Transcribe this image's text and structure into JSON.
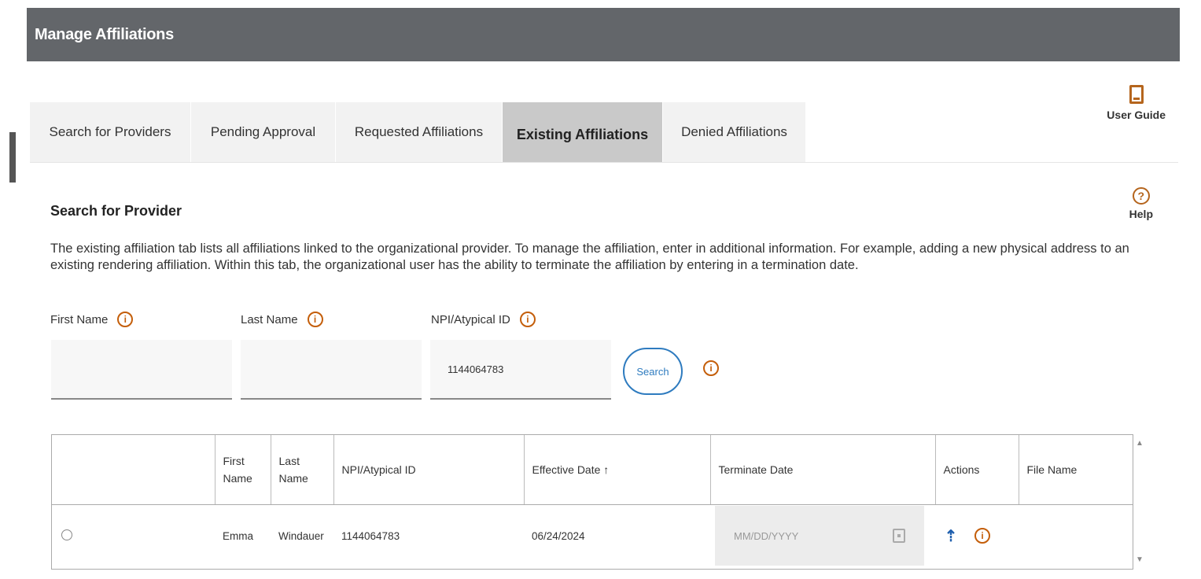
{
  "header": {
    "title": "Manage Affiliations"
  },
  "tabs": [
    {
      "label": "Search for Providers",
      "active": false
    },
    {
      "label": "Pending Approval",
      "active": false
    },
    {
      "label": "Requested Affiliations",
      "active": false
    },
    {
      "label": "Existing Affiliations",
      "active": true
    },
    {
      "label": "Denied Affiliations",
      "active": false
    }
  ],
  "user_guide": {
    "label": "User Guide",
    "icon": "book-icon"
  },
  "help": {
    "label": "Help",
    "icon": "question-circle-icon"
  },
  "section": {
    "title": "Search for Provider",
    "description": "The existing affiliation tab lists all affiliations linked to the organizational provider. To manage the affiliation, enter in additional information. For example, adding a new physical address to an existing rendering affiliation. Within this tab, the organizational user has the ability to terminate the affiliation by entering in a termination date."
  },
  "search_form": {
    "first_name": {
      "label": "First Name",
      "value": ""
    },
    "last_name": {
      "label": "Last Name",
      "value": ""
    },
    "npi": {
      "label": "NPI/Atypical ID",
      "value": "1144064783"
    },
    "search_button": "Search"
  },
  "table": {
    "headers": {
      "first_name_line1": "First",
      "first_name_line2": "Name",
      "last_name_line1": "Last",
      "last_name_line2": "Name",
      "npi": "NPI/Atypical ID",
      "effective_date": "Effective Date ↑",
      "terminate_date": "Terminate Date",
      "actions": "Actions",
      "file_name": "File Name"
    },
    "rows": [
      {
        "first_name": "Emma",
        "last_name": "Windauer",
        "npi": "1144064783",
        "effective_date": "06/24/2024",
        "terminate_date_placeholder": "MM/DD/YYYY",
        "file_name": ""
      }
    ]
  },
  "colors": {
    "header_bg": "#63666a",
    "accent_orange": "#c45e0a",
    "link_blue": "#2e7bbf",
    "active_tab": "#c9c9c9"
  }
}
